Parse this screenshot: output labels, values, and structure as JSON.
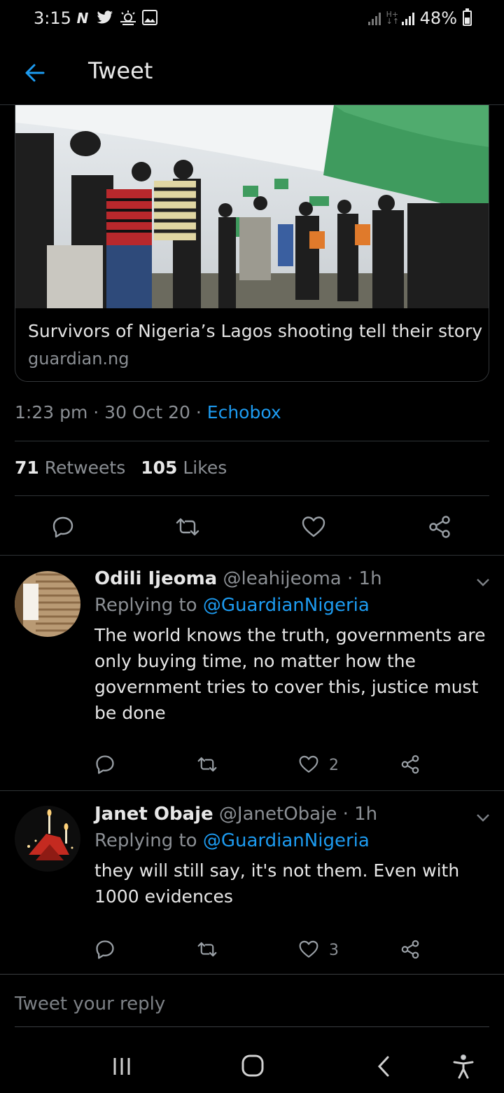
{
  "status_bar": {
    "time": "3:15",
    "battery": "48%"
  },
  "header": {
    "title": "Tweet"
  },
  "card": {
    "title": "Survivors of Nigeria’s Lagos shooting tell their story",
    "domain": "guardian.ng"
  },
  "tweet_meta": {
    "time": "1:23 pm",
    "date": "30 Oct 20",
    "source": "Echobox"
  },
  "stats": {
    "retweets_count": "71",
    "retweets_label": "Retweets",
    "likes_count": "105",
    "likes_label": "Likes"
  },
  "replies": [
    {
      "name": "Odili Ijeoma",
      "handle": "@leahijeoma",
      "time": "1h",
      "replying_label": "Replying to",
      "mention": "@GuardianNigeria",
      "text": "The world knows the truth, governments are only buying time, no matter how the government tries to cover this, justice must be done",
      "likes": "2"
    },
    {
      "name": "Janet Obaje",
      "handle": "@JanetObaje",
      "time": "1h",
      "replying_label": "Replying to",
      "mention": "@GuardianNigeria",
      "text": "they will still say, it's not them. Even with 1000 evidences",
      "likes": "3"
    }
  ],
  "compose": {
    "placeholder": "Tweet your reply"
  },
  "colors": {
    "background": "#000000",
    "accent": "#1d9bf0",
    "secondary_text": "#8b8f94",
    "divider": "#2f3336"
  }
}
